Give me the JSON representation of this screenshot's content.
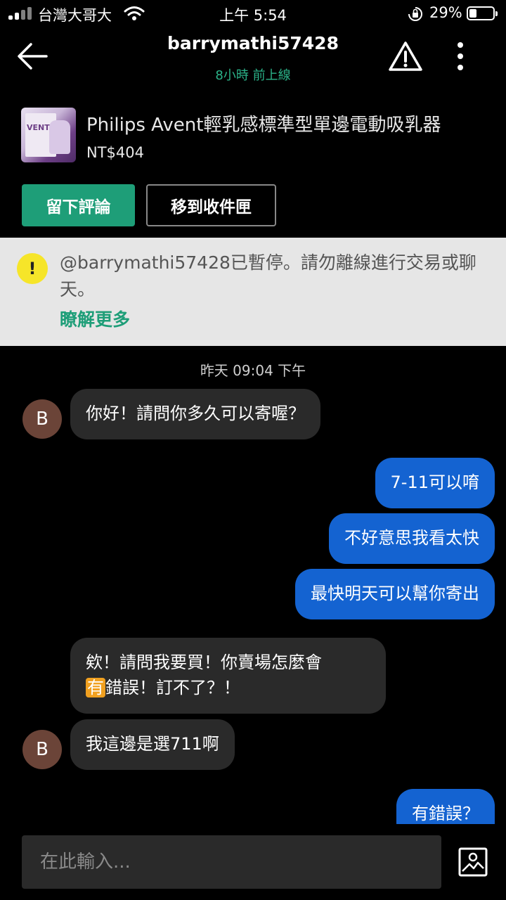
{
  "status_bar": {
    "carrier": "台灣大哥大",
    "time": "上午 5:54",
    "battery": "29%"
  },
  "header": {
    "username": "barrymathi57428",
    "last_online": "8小時 前上線",
    "icons": [
      "back-arrow-icon",
      "warning-triangle-icon",
      "more-vertical-icon"
    ]
  },
  "product": {
    "name": "Philips Avent輕乳感標準型單邊電動吸乳器",
    "price": "NT$404",
    "thumb_brand": "VENT"
  },
  "actions": {
    "review_label": "留下評論",
    "inbox_label": "移到收件匣"
  },
  "banner": {
    "text": "@barrymathi57428已暫停。請勿離線進行交易或聊天。",
    "link": "瞭解更多",
    "icon": "!"
  },
  "chat": {
    "date": "昨天 09:04 下午",
    "avatar_letter": "B",
    "messages": [
      {
        "side": "in",
        "text": "你好！請問你多久可以寄喔？"
      },
      {
        "side": "out",
        "text": "7-11可以唷"
      },
      {
        "side": "out",
        "text": "不好意思我看太快"
      },
      {
        "side": "out",
        "text": "最快明天可以幫你寄出"
      },
      {
        "side": "in",
        "line1": "欸！請問我要買！你賣場怎麼會",
        "highlight": "有",
        "line2_rest": "錯誤！訂不了？！"
      },
      {
        "side": "in",
        "text": "我這邊是選711啊"
      },
      {
        "side": "out",
        "text": "有錯誤？"
      }
    ]
  },
  "composer": {
    "placeholder": "在此輸入..."
  },
  "colors": {
    "accent_green": "#1e9e78",
    "outgoing_bubble": "#1463d1",
    "incoming_bubble": "#2a2a2a"
  }
}
